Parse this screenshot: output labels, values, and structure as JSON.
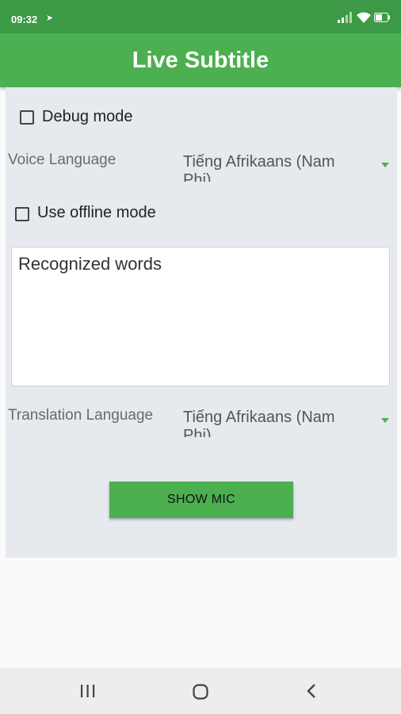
{
  "status_bar": {
    "time": "09:32",
    "nav_icon": "location-arrow-icon",
    "icons": [
      "signal-icon",
      "wifi-icon",
      "battery-icon"
    ]
  },
  "app_bar": {
    "title": "Live Subtitle",
    "color": "#4caf50"
  },
  "form": {
    "debug_mode": {
      "label": "Debug mode",
      "checked": false
    },
    "voice_language": {
      "label": "Voice Language",
      "value": "Tiếng Afrikaans (Nam Phi)"
    },
    "offline_mode": {
      "label": "Use offline mode",
      "checked": false
    },
    "recognized_words": "Recognized words",
    "translation_language": {
      "label": "Translation Language",
      "value": "Tiếng Afrikaans (Nam Phi)"
    },
    "show_mic_label": "SHOW MIC"
  },
  "nav_bar": {
    "icons": [
      "recent-apps-icon",
      "home-icon",
      "back-icon"
    ]
  }
}
